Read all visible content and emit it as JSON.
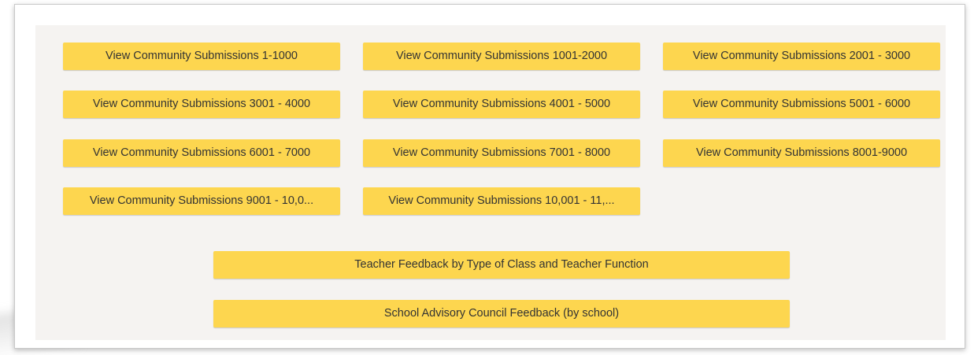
{
  "grid_buttons": [
    {
      "label": "View Community Submissions 1-1000"
    },
    {
      "label": "View Community Submissions 1001-2000"
    },
    {
      "label": "View Community Submissions 2001 - 3000"
    },
    {
      "label": "View Community Submissions 3001 - 4000"
    },
    {
      "label": "View Community Submissions 4001 - 5000"
    },
    {
      "label": "View Community Submissions 5001 - 6000"
    },
    {
      "label": "View Community Submissions 6001 - 7000"
    },
    {
      "label": "View Community Submissions 7001 - 8000"
    },
    {
      "label": "View Community Submissions 8001-9000"
    },
    {
      "label": "View Community Submissions 9001 - 10,0..."
    },
    {
      "label": "View Community Submissions 10,001 - 11,..."
    }
  ],
  "feedback_buttons": {
    "teacher_label": "Teacher Feedback by Type of Class and Teacher Function",
    "sac_label": "School Advisory Council Feedback (by school)"
  },
  "colors": {
    "button_bg": "#fdd64f",
    "panel_bg": "#f5f3f1",
    "text": "#333333"
  }
}
